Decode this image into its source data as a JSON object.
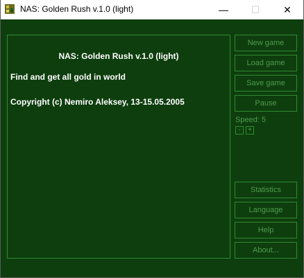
{
  "window": {
    "title": "NAS: Golden Rush v.1.0 (light)",
    "controls": {
      "minimize": "—",
      "maximize": "☐",
      "close": "✕"
    }
  },
  "panel": {
    "heading": "NAS: Golden Rush v.1.0 (light)",
    "description": "Find and get all gold in world",
    "copyright": "Copyright (c) Nemiro Aleksey, 13-15.05.2005"
  },
  "buttons": {
    "new_game": "New game",
    "load_game": "Load game",
    "save_game": "Save game",
    "pause": "Pause",
    "statistics": "Statistics",
    "language": "Language",
    "help": "Help",
    "about": "About..."
  },
  "speed": {
    "label": "Speed:",
    "value": "5",
    "decrease": "-",
    "increase": "+"
  },
  "colors": {
    "background": "#0e3e0e",
    "border": "#2f8a2f",
    "disabled_text": "#4d9c4d",
    "text": "#ffffff"
  }
}
